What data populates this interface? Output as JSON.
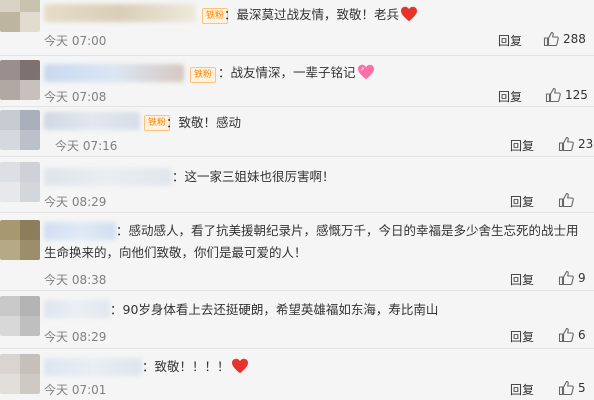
{
  "comments": [
    {
      "badge": "铁粉",
      "text": "：最深莫过战友情，致敬！老兵",
      "emoji": "red-heart",
      "time": "今天 07:00",
      "reply": "回复",
      "likes": "288"
    },
    {
      "badge": "铁粉",
      "text": "：战友情深，一辈子铭记",
      "emoji": "pink-heart",
      "time": "今天 07:08",
      "reply": "回复",
      "likes": "125"
    },
    {
      "badge": "铁粉",
      "text": "：致敬！感动",
      "time": "今天 07:16",
      "reply": "回复",
      "likes": "23"
    },
    {
      "text": "：这一家三姐妹也很厉害啊！",
      "time": "今天 08:29",
      "reply": "回复",
      "likes": ""
    },
    {
      "text": "：感动感人，看了抗美援朝纪录片，感慨万千，今日的幸福是多少舍生忘死的战士用生命换来的，向他们致敬，你们是最可爱的人！",
      "time": "今天 08:38",
      "reply": "回复",
      "likes": "9"
    },
    {
      "text": "：90岁身体看上去还挺硬朗，希望英雄福如东海，寿比南山",
      "time": "今天 08:29",
      "reply": "回复",
      "likes": "6"
    },
    {
      "text": "：致敬！！！！",
      "emoji": "red-heart",
      "time": "今天 07:01",
      "reply": "回复",
      "likes": "5"
    }
  ]
}
